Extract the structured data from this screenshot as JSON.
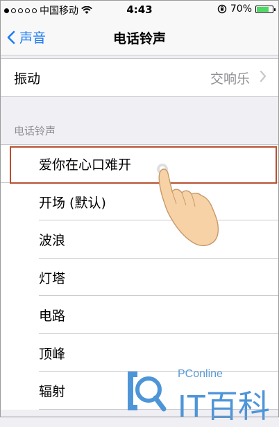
{
  "status_bar": {
    "carrier": "中国移动",
    "time": "4:43",
    "battery_percent": "70%",
    "battery_level": 0.7
  },
  "nav": {
    "back_label": "声音",
    "title": "电话铃声"
  },
  "vibration": {
    "label": "振动",
    "value": "交响乐"
  },
  "section": {
    "header": "电话铃声"
  },
  "ringtones": [
    {
      "label": "爱你在心口难开",
      "selected": true
    },
    {
      "label": "开场 (默认)"
    },
    {
      "label": "波浪"
    },
    {
      "label": "灯塔"
    },
    {
      "label": "电路"
    },
    {
      "label": "顶峰"
    },
    {
      "label": "辐射"
    }
  ],
  "watermark": {
    "small": "PConline",
    "big": "IT百科"
  },
  "colors": {
    "ios_blue": "#1a7cf5",
    "highlight": "#b8502f",
    "battery_green": "#4cd964",
    "watermark_blue": "#4e95d8"
  },
  "icons": [
    "signal-dots-icon",
    "wifi-icon",
    "rotation-lock-icon",
    "battery-icon",
    "chevron-left-icon",
    "chevron-right-icon",
    "pointing-hand-icon",
    "itbaike-logo-icon"
  ]
}
